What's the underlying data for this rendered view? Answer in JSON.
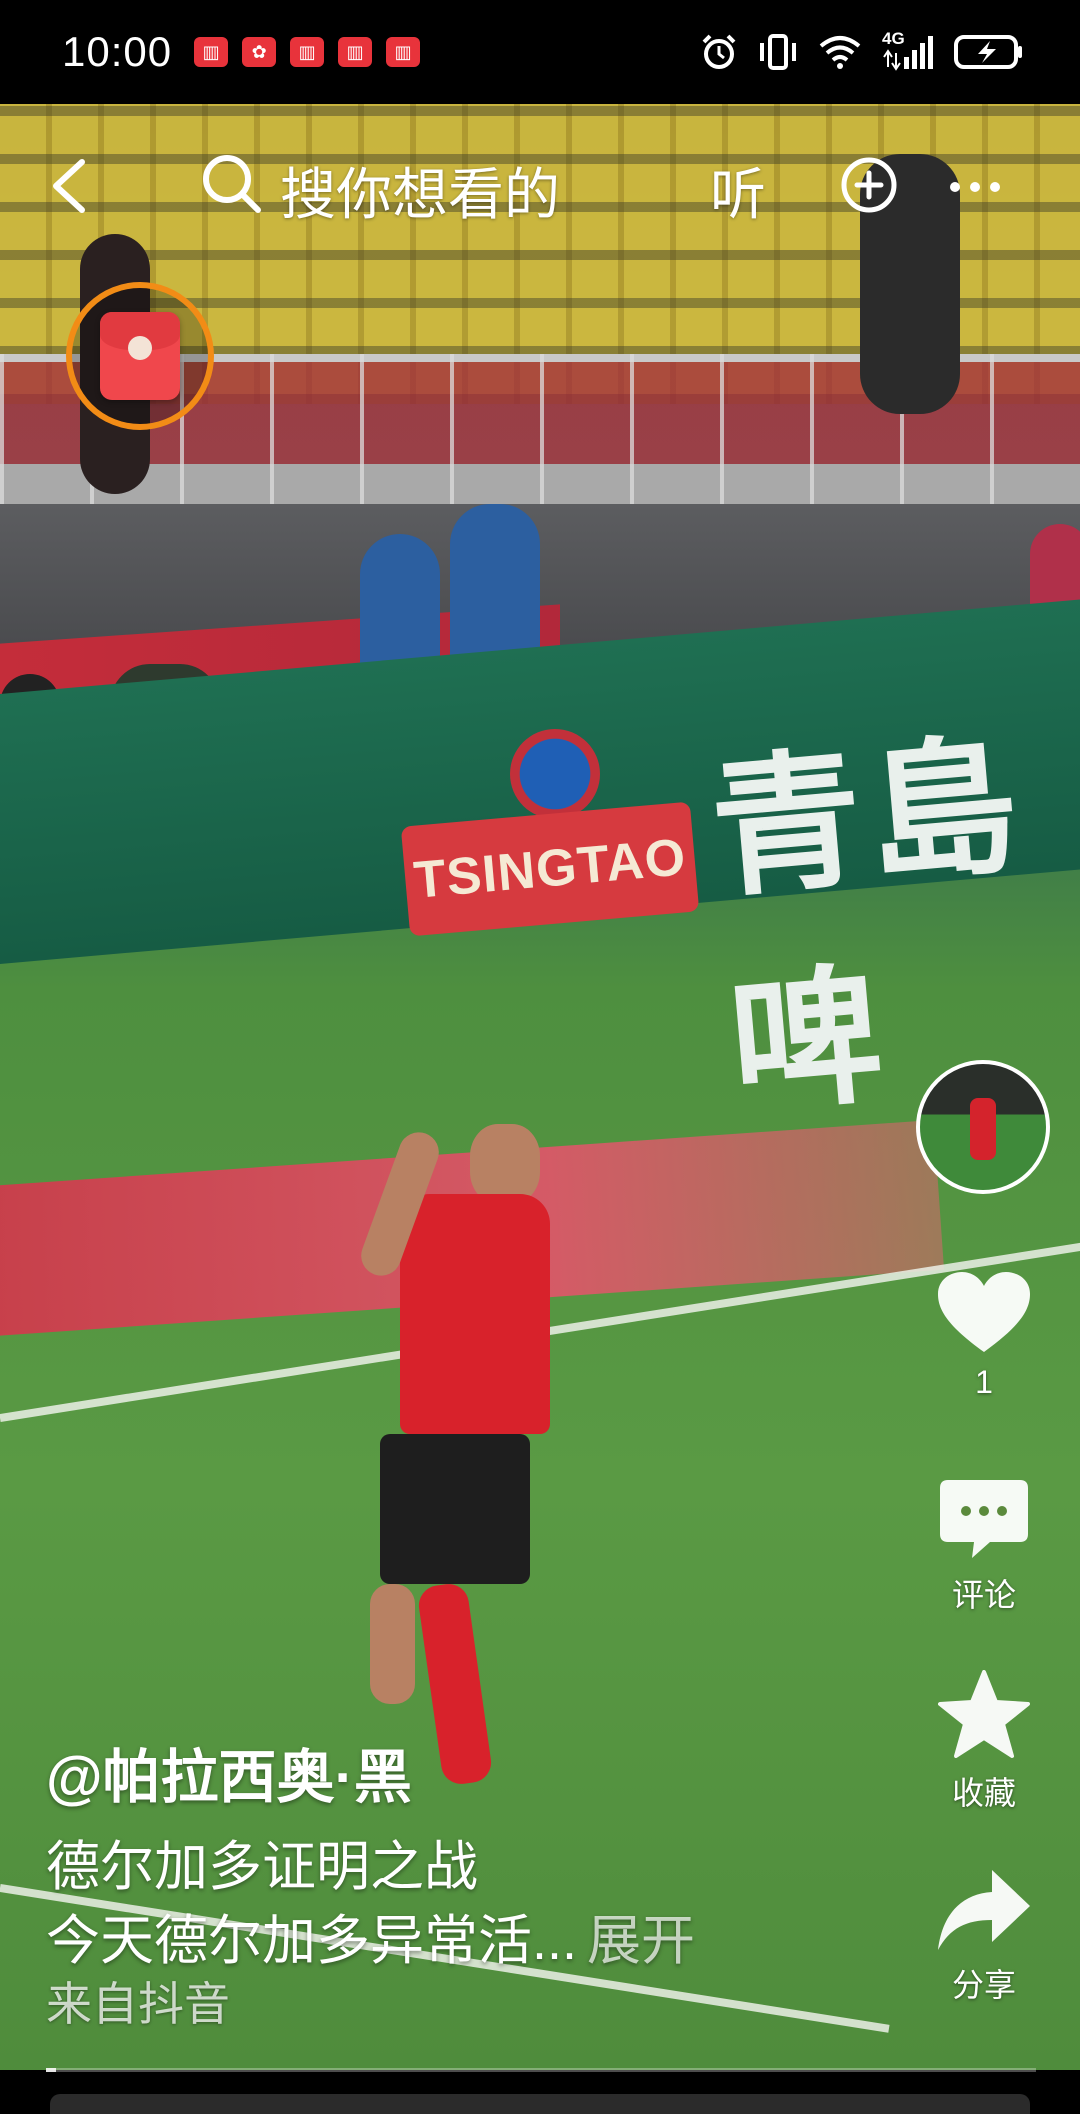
{
  "status_bar": {
    "time": "10:00",
    "notifications": [
      "book-icon",
      "huawei-icon",
      "book-icon",
      "book-icon",
      "book-icon"
    ],
    "right_icons": [
      "alarm-icon",
      "vibrate-icon",
      "wifi-icon",
      "4g-signal-icon",
      "battery-charging-icon"
    ],
    "network_label": "4G"
  },
  "top_bar": {
    "search_hint": "搜你想看的",
    "listen_label": "听"
  },
  "video": {
    "ad_logo_text": "TSINGTAO",
    "ad_chinese_text": "青島啤"
  },
  "actions": {
    "like_count": "1",
    "comment_label": "评论",
    "favorite_label": "收藏",
    "share_label": "分享"
  },
  "caption": {
    "author": "@帕拉西奥·黑",
    "title": "德尔加多证明之战",
    "body": "今天德尔加多异常活...",
    "expand_label": "展开",
    "source": "来自抖音"
  },
  "playback": {
    "progress": 0.01
  },
  "colors": {
    "accent_orange": "#f28c16",
    "red_packet": "#f0474c",
    "notification_red": "#e8333b"
  }
}
